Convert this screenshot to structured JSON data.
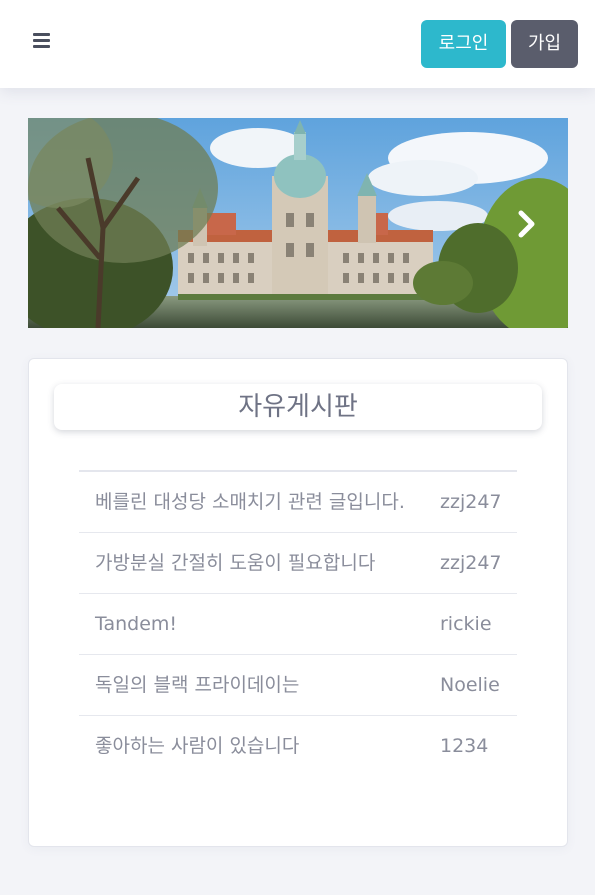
{
  "header": {
    "menu_icon": "hamburger-menu-icon",
    "login_label": "로그인",
    "join_label": "가입",
    "login_color": "#2db8cc",
    "join_color": "#5a5d6c"
  },
  "carousel": {
    "image": "city-hall-photo",
    "next_icon": "chevron-right-icon"
  },
  "board": {
    "title": "자유게시판",
    "posts": [
      {
        "title": "베를린 대성당 소매치기 관련 글입니다.",
        "author": "zzj247"
      },
      {
        "title": "가방분실 간절히 도움이 필요합니다",
        "author": "zzj247"
      },
      {
        "title": "Tandem!",
        "author": "rickie"
      },
      {
        "title": "독일의 블랙 프라이데이는",
        "author": "Noelie"
      },
      {
        "title": "좋아하는 사람이 있습니다",
        "author": "1234"
      }
    ]
  }
}
